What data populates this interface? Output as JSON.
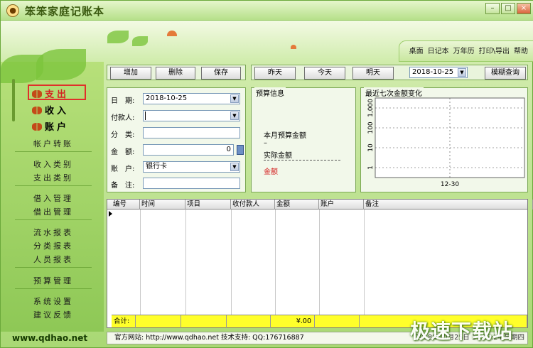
{
  "app": {
    "title": "笨笨家庭记账本",
    "icon": "bear-face-icon"
  },
  "window_controls": {
    "minimize": "–",
    "maximize": "□",
    "close": "×"
  },
  "toplinks": [
    "桌面",
    "日记本",
    "万年历",
    "打印\\导出",
    "帮助"
  ],
  "sidebar": {
    "main": [
      {
        "label": "支出",
        "active": true
      },
      {
        "label": "收入",
        "active": false
      },
      {
        "label": "账户",
        "active": false
      }
    ],
    "groups": [
      [
        "帐户转账"
      ],
      [
        "收入类别",
        "支出类别"
      ],
      [
        "借入管理",
        "借出管理"
      ],
      [
        "流水报表",
        "分类报表",
        "人员报表"
      ],
      [
        "预算管理"
      ],
      [
        "系统设置",
        "建议反馈"
      ]
    ],
    "site": "www.qdhao.net"
  },
  "toolbar": {
    "add": "增加",
    "delete": "删除",
    "save": "保存",
    "yesterday": "昨天",
    "today": "今天",
    "tomorrow": "明天",
    "date": "2018-10-25",
    "fuzzy_query": "模糊查询"
  },
  "form": {
    "date_label": "日　期:",
    "date_value": "2018-10-25",
    "payer_label": "付款人:",
    "payer_value": "",
    "category_label": "分　类:",
    "category_value": "",
    "amount_label": "金　额:",
    "amount_value": "0",
    "account_label": "账　户:",
    "account_value": "银行卡",
    "note_label": "备　注:",
    "note_value": ""
  },
  "budget": {
    "title": "预算信息",
    "this_month": "本月预算金额",
    "dash1": "–",
    "actual": "实际金额",
    "amount_red": "金额",
    "red_color": "#d42020"
  },
  "chart_data": {
    "type": "line",
    "title": "最近七次金额变化",
    "x": [
      "12-30"
    ],
    "y_ticks": [
      "1,000",
      "100",
      "10",
      "1"
    ],
    "log_scale": true,
    "series": [],
    "grid": true
  },
  "table": {
    "columns": [
      "编号",
      "时间",
      "项目",
      "收付款人",
      "金额",
      "账户",
      "备注"
    ],
    "rows": [],
    "total_label": "合计:",
    "total_amount": "¥.00",
    "total_color": "#ffff2a"
  },
  "statusbar": {
    "left": "官方网站: http://www.qdhao.net   技术支持: QQ:176716887",
    "right": "2018年10月25日   17:23:24   星期四"
  },
  "watermark": "极速下载站"
}
